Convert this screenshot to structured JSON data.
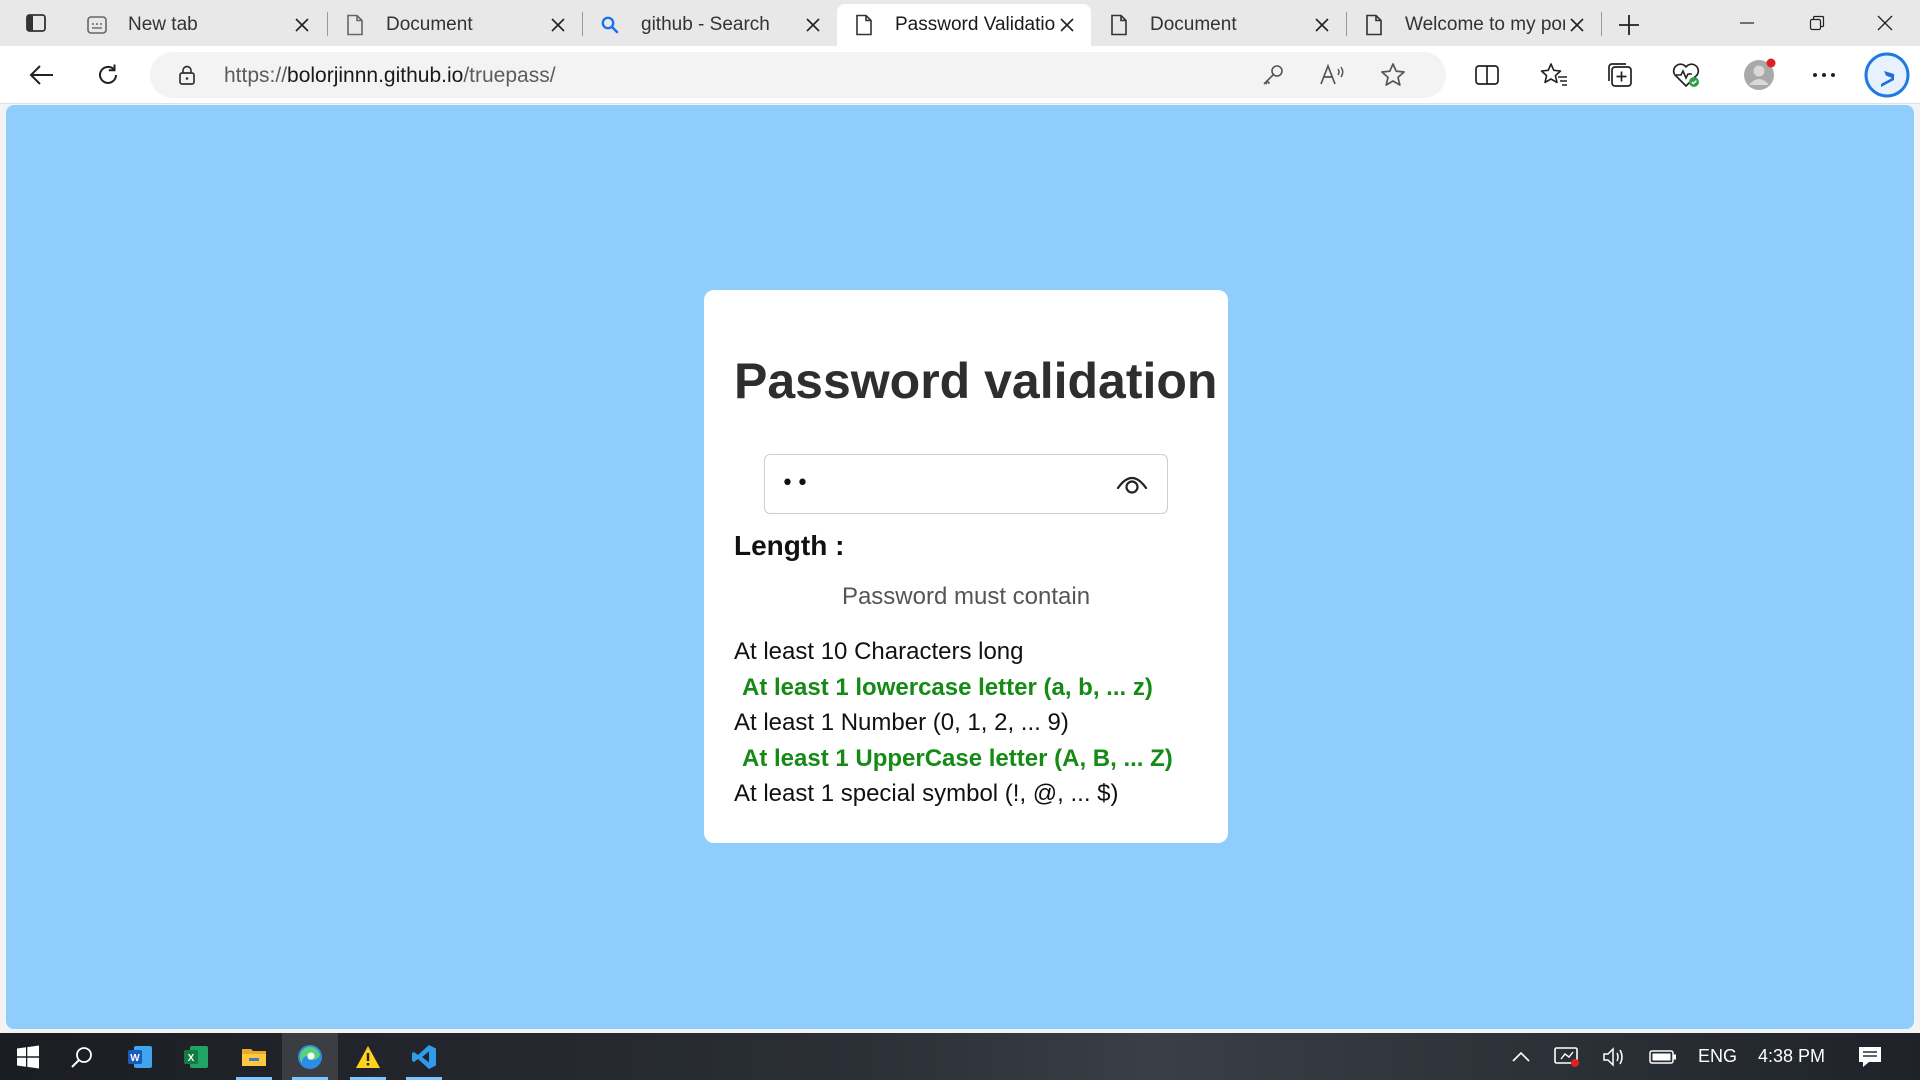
{
  "browser": {
    "tabs": [
      {
        "title": "New tab",
        "icon": "new-tab-page-icon",
        "active": false
      },
      {
        "title": "Document",
        "icon": "page-icon",
        "active": false
      },
      {
        "title": "github - Search",
        "icon": "search-icon",
        "active": false
      },
      {
        "title": "Password Validation",
        "icon": "page-icon",
        "active": true
      },
      {
        "title": "Document",
        "icon": "page-icon",
        "active": false
      },
      {
        "title": "Welcome to my por",
        "icon": "page-icon",
        "active": false
      }
    ],
    "address": {
      "scheme": "https://",
      "host": "bolorjinnn.github.io",
      "path": "/truepass/"
    }
  },
  "page": {
    "background_color": "#8ecdfc",
    "title": "Password validation",
    "password_value": "••",
    "length_label": "Length :",
    "requirements_heading": "Password must contain",
    "requirements": [
      {
        "text": "At least 10 Characters long",
        "met": false
      },
      {
        "text": "At least 1 lowercase letter (a, b, ... z)",
        "met": true
      },
      {
        "text": "At least 1 Number (0, 1, 2, ... 9)",
        "met": false
      },
      {
        "text": "At least 1 UpperCase letter (A, B, ... Z)",
        "met": true
      },
      {
        "text": "At least 1 special symbol (!, @, ... $)",
        "met": false
      }
    ],
    "met_color": "#158a15"
  },
  "taskbar": {
    "apps": [
      "start-icon",
      "search-icon",
      "word-icon",
      "excel-icon",
      "file-explorer-icon",
      "edge-icon",
      "warning-icon",
      "vscode-icon"
    ],
    "language": "ENG",
    "time": "4:38 PM"
  }
}
